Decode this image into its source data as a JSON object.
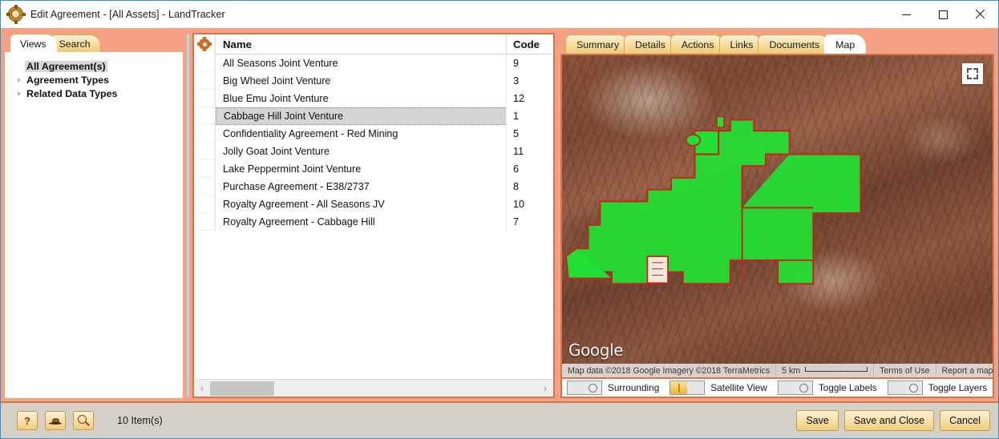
{
  "window": {
    "title": "Edit Agreement - [All Assets] - LandTracker",
    "app_icon": "gear-app-icon",
    "controls": {
      "minimize": "minimize-icon",
      "maximize": "maximize-icon",
      "close": "close-icon"
    }
  },
  "left_panel": {
    "tabs": [
      {
        "label": "Views",
        "active": true
      },
      {
        "label": "Search",
        "active": false
      }
    ],
    "tree": [
      {
        "label": "All Agreement(s)",
        "has_arrow": false,
        "selected": true
      },
      {
        "label": "Agreement Types",
        "has_arrow": true,
        "selected": false
      },
      {
        "label": "Related Data Types",
        "has_arrow": true,
        "selected": false
      }
    ]
  },
  "list_panel": {
    "gear_icon": "gear-icon",
    "columns": [
      "Name",
      "Code"
    ],
    "rows": [
      {
        "name": "All Seasons Joint Venture",
        "code": "9",
        "selected": false
      },
      {
        "name": "Big Wheel Joint Venture",
        "code": "3",
        "selected": false
      },
      {
        "name": "Blue Emu Joint Venture",
        "code": "12",
        "selected": false
      },
      {
        "name": "Cabbage Hill Joint Venture",
        "code": "1",
        "selected": true
      },
      {
        "name": "Confidentiality Agreement - Red Mining",
        "code": "5",
        "selected": false
      },
      {
        "name": "Jolly Goat Joint Venture",
        "code": "11",
        "selected": false
      },
      {
        "name": "Lake Peppermint Joint Venture",
        "code": "6",
        "selected": false
      },
      {
        "name": "Purchase Agreement - E38/2737",
        "code": "8",
        "selected": false
      },
      {
        "name": "Royalty Agreement - All Seasons JV",
        "code": "10",
        "selected": false
      },
      {
        "name": "Royalty Agreement - Cabbage Hill",
        "code": "7",
        "selected": false
      }
    ],
    "scrollbar": {
      "left_arrow": "chevron-left-icon",
      "right_arrow": "chevron-right-icon"
    }
  },
  "right_panel": {
    "tabs": [
      {
        "label": "Summary",
        "active": false
      },
      {
        "label": "Details",
        "active": false
      },
      {
        "label": "Actions",
        "active": false
      },
      {
        "label": "Links",
        "active": false
      },
      {
        "label": "Documents",
        "active": false
      },
      {
        "label": "Map",
        "active": true
      }
    ],
    "map": {
      "fullscreen_icon": "fullscreen-expand-icon",
      "watermark": "Google",
      "attribution": "Map data ©2018 Google Imagery ©2018 TerraMetrics",
      "scale_label": "5 km",
      "terms_link": "Terms of Use",
      "report_link": "Report a map error",
      "polygon_fill": "#22e033",
      "polygon_stroke": "#c0281e"
    },
    "map_toolbar": [
      {
        "label": "Surrounding",
        "state": "off"
      },
      {
        "label": "Satellite View",
        "state": "on"
      },
      {
        "label": "Toggle Labels",
        "state": "off"
      },
      {
        "label": "Toggle Layers",
        "state": "off"
      }
    ]
  },
  "bottom_bar": {
    "help_button": "?",
    "icons": [
      "help-icon",
      "detective-hat-icon",
      "magnifier-icon"
    ],
    "status": "10 Item(s)",
    "actions": [
      {
        "label": "Save"
      },
      {
        "label": "Save and Close"
      },
      {
        "label": "Cancel"
      }
    ]
  },
  "colors": {
    "window_accent": "#f7a184",
    "panel_border": "#d4764c",
    "tab_gold": "#f0cf85",
    "selection_gray": "#d5d5d5",
    "title_border": "#2f8fd8"
  }
}
